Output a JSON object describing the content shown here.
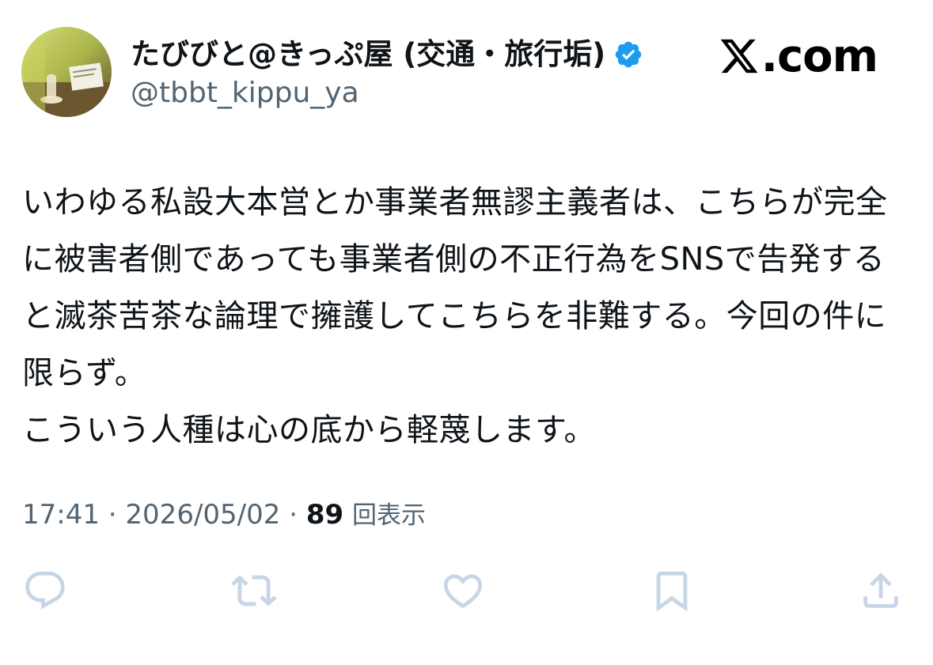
{
  "author": {
    "display_name": "たびびと@きっぷ屋 (交通・旅行垢)",
    "handle": "@tbbt_kippu_ya",
    "verified": true,
    "avatar_icon": "profile-photo"
  },
  "brand": {
    "text": ".com",
    "logo_icon": "x-logo-icon"
  },
  "tweet": {
    "text": "いわゆる私設大本営とか事業者無謬主義者は、こちらが完全に被害者側であっても事業者側の不正行為をSNSで告発すると滅茶苦茶な論理で擁護してこちらを非難する。今回の件に限らず。\nこういう人種は心の底から軽蔑します。"
  },
  "meta": {
    "time": "17:41",
    "separator": "·",
    "date": "2026/05/02",
    "views_count": "89",
    "views_label": "回表示"
  },
  "actions": [
    {
      "name": "reply-icon"
    },
    {
      "name": "repost-icon"
    },
    {
      "name": "like-icon"
    },
    {
      "name": "bookmark-icon"
    },
    {
      "name": "share-icon"
    }
  ],
  "colors": {
    "text_primary": "#0f1419",
    "text_secondary": "#536471",
    "verified_blue": "#1d9bf0",
    "action_icon": "#c7d6e6"
  }
}
